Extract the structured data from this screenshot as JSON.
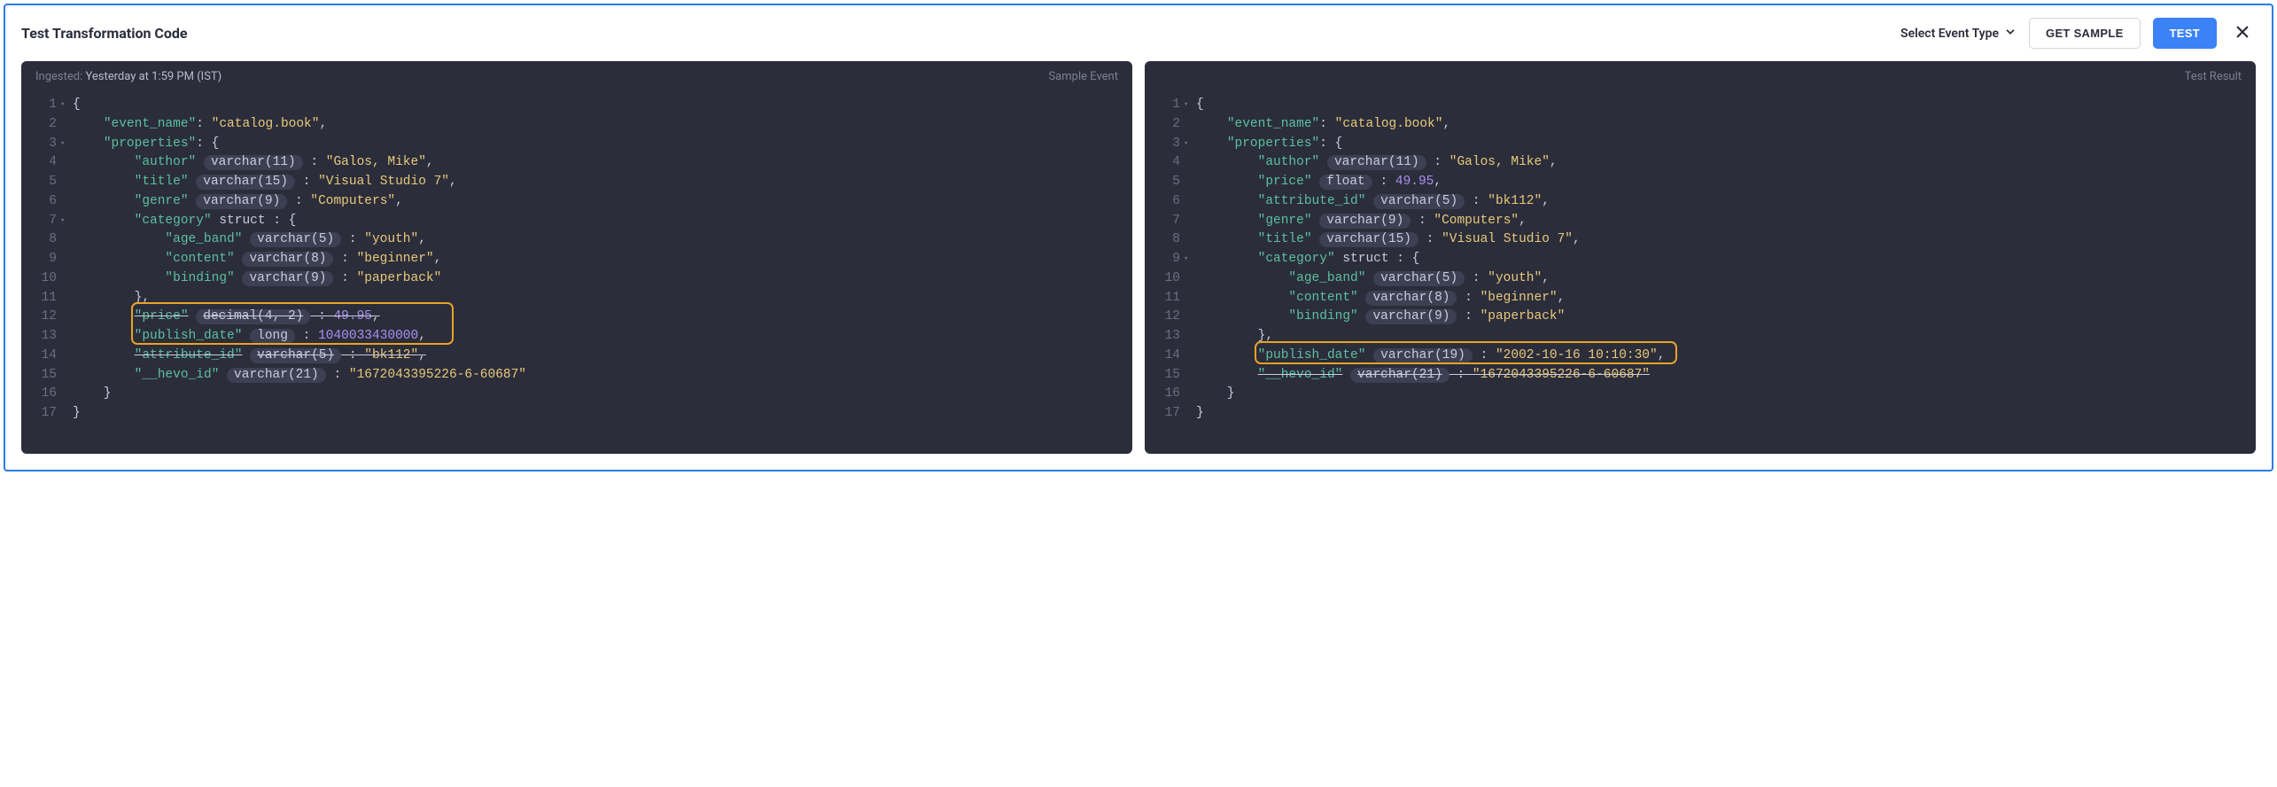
{
  "header": {
    "title": "Test Transformation Code",
    "select_event": "Select Event Type",
    "get_sample": "GET SAMPLE",
    "test": "TEST"
  },
  "left": {
    "ingested_label": "Ingested:",
    "ingested_time": "Yesterday at 1:59 PM (IST)",
    "tag": "Sample Event",
    "lines": [
      {
        "n": "1",
        "fold": "▾",
        "tokens": [
          {
            "t": "{",
            "c": "tok-punct"
          }
        ]
      },
      {
        "n": "2",
        "tokens": [
          {
            "t": "    "
          },
          {
            "t": "\"event_name\"",
            "c": "tok-key"
          },
          {
            "t": ": ",
            "c": "tok-punct"
          },
          {
            "t": "\"catalog.book\"",
            "c": "tok-str"
          },
          {
            "t": ",",
            "c": "tok-punct"
          }
        ]
      },
      {
        "n": "3",
        "fold": "▾",
        "tokens": [
          {
            "t": "    "
          },
          {
            "t": "\"properties\"",
            "c": "tok-key"
          },
          {
            "t": ": {",
            "c": "tok-punct"
          }
        ]
      },
      {
        "n": "4",
        "tokens": [
          {
            "t": "        "
          },
          {
            "t": "\"author\"",
            "c": "tok-key"
          },
          {
            "t": " "
          },
          {
            "t": "varchar(11)",
            "c": "tok-type"
          },
          {
            "t": " : ",
            "c": "tok-punct"
          },
          {
            "t": "\"Galos, Mike\"",
            "c": "tok-str"
          },
          {
            "t": ",",
            "c": "tok-punct"
          }
        ]
      },
      {
        "n": "5",
        "tokens": [
          {
            "t": "        "
          },
          {
            "t": "\"title\"",
            "c": "tok-key"
          },
          {
            "t": " "
          },
          {
            "t": "varchar(15)",
            "c": "tok-type"
          },
          {
            "t": " : ",
            "c": "tok-punct"
          },
          {
            "t": "\"Visual Studio 7\"",
            "c": "tok-str"
          },
          {
            "t": ",",
            "c": "tok-punct"
          }
        ]
      },
      {
        "n": "6",
        "tokens": [
          {
            "t": "        "
          },
          {
            "t": "\"genre\"",
            "c": "tok-key"
          },
          {
            "t": " "
          },
          {
            "t": "varchar(9)",
            "c": "tok-type"
          },
          {
            "t": " : ",
            "c": "tok-punct"
          },
          {
            "t": "\"Computers\"",
            "c": "tok-str"
          },
          {
            "t": ",",
            "c": "tok-punct"
          }
        ]
      },
      {
        "n": "7",
        "fold": "▾",
        "tokens": [
          {
            "t": "        "
          },
          {
            "t": "\"category\"",
            "c": "tok-key"
          },
          {
            "t": " "
          },
          {
            "t": "struct",
            "c": "tok-kw"
          },
          {
            "t": " : {",
            "c": "tok-punct"
          }
        ]
      },
      {
        "n": "8",
        "tokens": [
          {
            "t": "            "
          },
          {
            "t": "\"age_band\"",
            "c": "tok-key"
          },
          {
            "t": " "
          },
          {
            "t": "varchar(5)",
            "c": "tok-type"
          },
          {
            "t": " : ",
            "c": "tok-punct"
          },
          {
            "t": "\"youth\"",
            "c": "tok-str"
          },
          {
            "t": ",",
            "c": "tok-punct"
          }
        ]
      },
      {
        "n": "9",
        "tokens": [
          {
            "t": "            "
          },
          {
            "t": "\"content\"",
            "c": "tok-key"
          },
          {
            "t": " "
          },
          {
            "t": "varchar(8)",
            "c": "tok-type"
          },
          {
            "t": " : ",
            "c": "tok-punct"
          },
          {
            "t": "\"beginner\"",
            "c": "tok-str"
          },
          {
            "t": ",",
            "c": "tok-punct"
          }
        ]
      },
      {
        "n": "10",
        "tokens": [
          {
            "t": "            "
          },
          {
            "t": "\"binding\"",
            "c": "tok-key"
          },
          {
            "t": " "
          },
          {
            "t": "varchar(9)",
            "c": "tok-type"
          },
          {
            "t": " : ",
            "c": "tok-punct"
          },
          {
            "t": "\"paperback\"",
            "c": "tok-str"
          }
        ]
      },
      {
        "n": "11",
        "tokens": [
          {
            "t": "        },",
            "c": "tok-punct"
          }
        ]
      },
      {
        "n": "12",
        "tokens": [
          {
            "t": "        "
          },
          {
            "t": "\"price\"",
            "c": "tok-key strike"
          },
          {
            "t": " "
          },
          {
            "t": "decimal(4, 2)",
            "c": "tok-type strike"
          },
          {
            "t": " : ",
            "c": "tok-punct strike"
          },
          {
            "t": "49.95",
            "c": "tok-num strike"
          },
          {
            "t": ",",
            "c": "tok-punct strike"
          }
        ]
      },
      {
        "n": "13",
        "tokens": [
          {
            "t": "        "
          },
          {
            "t": "\"publish_date\"",
            "c": "tok-key"
          },
          {
            "t": " "
          },
          {
            "t": "long",
            "c": "tok-type"
          },
          {
            "t": " : ",
            "c": "tok-punct"
          },
          {
            "t": "1040033430000",
            "c": "tok-num"
          },
          {
            "t": ",",
            "c": "tok-punct"
          }
        ]
      },
      {
        "n": "14",
        "tokens": [
          {
            "t": "        "
          },
          {
            "t": "\"attribute_id\"",
            "c": "tok-key strike"
          },
          {
            "t": " "
          },
          {
            "t": "varchar(5)",
            "c": "tok-type strike"
          },
          {
            "t": " : ",
            "c": "tok-punct strike"
          },
          {
            "t": "\"bk112\"",
            "c": "tok-str strike"
          },
          {
            "t": ",",
            "c": "tok-punct strike"
          }
        ]
      },
      {
        "n": "15",
        "tokens": [
          {
            "t": "        "
          },
          {
            "t": "\"__hevo_id\"",
            "c": "tok-key"
          },
          {
            "t": " "
          },
          {
            "t": "varchar(21)",
            "c": "tok-type"
          },
          {
            "t": " : ",
            "c": "tok-punct"
          },
          {
            "t": "\"1672043395226-6-60687\"",
            "c": "tok-str"
          }
        ]
      },
      {
        "n": "16",
        "tokens": [
          {
            "t": "    }",
            "c": "tok-punct"
          }
        ]
      },
      {
        "n": "17",
        "tokens": [
          {
            "t": "}",
            "c": "tok-punct"
          }
        ]
      }
    ],
    "highlight": {
      "top_line": 12,
      "height_lines": 2,
      "left_ch": 8,
      "width_ch": 41
    }
  },
  "right": {
    "tag": "Test Result",
    "lines": [
      {
        "n": "1",
        "fold": "▾",
        "tokens": [
          {
            "t": "{",
            "c": "tok-punct"
          }
        ]
      },
      {
        "n": "2",
        "tokens": [
          {
            "t": "    "
          },
          {
            "t": "\"event_name\"",
            "c": "tok-key"
          },
          {
            "t": ": ",
            "c": "tok-punct"
          },
          {
            "t": "\"catalog.book\"",
            "c": "tok-str"
          },
          {
            "t": ",",
            "c": "tok-punct"
          }
        ]
      },
      {
        "n": "3",
        "fold": "▾",
        "tokens": [
          {
            "t": "    "
          },
          {
            "t": "\"properties\"",
            "c": "tok-key"
          },
          {
            "t": ": {",
            "c": "tok-punct"
          }
        ]
      },
      {
        "n": "4",
        "tokens": [
          {
            "t": "        "
          },
          {
            "t": "\"author\"",
            "c": "tok-key"
          },
          {
            "t": " "
          },
          {
            "t": "varchar(11)",
            "c": "tok-type"
          },
          {
            "t": " : ",
            "c": "tok-punct"
          },
          {
            "t": "\"Galos, Mike\"",
            "c": "tok-str"
          },
          {
            "t": ",",
            "c": "tok-punct"
          }
        ]
      },
      {
        "n": "5",
        "tokens": [
          {
            "t": "        "
          },
          {
            "t": "\"price\"",
            "c": "tok-key"
          },
          {
            "t": " "
          },
          {
            "t": "float",
            "c": "tok-type"
          },
          {
            "t": " : ",
            "c": "tok-punct"
          },
          {
            "t": "49.95",
            "c": "tok-num"
          },
          {
            "t": ",",
            "c": "tok-punct"
          }
        ]
      },
      {
        "n": "6",
        "tokens": [
          {
            "t": "        "
          },
          {
            "t": "\"attribute_id\"",
            "c": "tok-key"
          },
          {
            "t": " "
          },
          {
            "t": "varchar(5)",
            "c": "tok-type"
          },
          {
            "t": " : ",
            "c": "tok-punct"
          },
          {
            "t": "\"bk112\"",
            "c": "tok-str"
          },
          {
            "t": ",",
            "c": "tok-punct"
          }
        ]
      },
      {
        "n": "7",
        "tokens": [
          {
            "t": "        "
          },
          {
            "t": "\"genre\"",
            "c": "tok-key"
          },
          {
            "t": " "
          },
          {
            "t": "varchar(9)",
            "c": "tok-type"
          },
          {
            "t": " : ",
            "c": "tok-punct"
          },
          {
            "t": "\"Computers\"",
            "c": "tok-str"
          },
          {
            "t": ",",
            "c": "tok-punct"
          }
        ]
      },
      {
        "n": "8",
        "tokens": [
          {
            "t": "        "
          },
          {
            "t": "\"title\"",
            "c": "tok-key"
          },
          {
            "t": " "
          },
          {
            "t": "varchar(15)",
            "c": "tok-type"
          },
          {
            "t": " : ",
            "c": "tok-punct"
          },
          {
            "t": "\"Visual Studio 7\"",
            "c": "tok-str"
          },
          {
            "t": ",",
            "c": "tok-punct"
          }
        ]
      },
      {
        "n": "9",
        "fold": "▾",
        "tokens": [
          {
            "t": "        "
          },
          {
            "t": "\"category\"",
            "c": "tok-key"
          },
          {
            "t": " "
          },
          {
            "t": "struct",
            "c": "tok-kw"
          },
          {
            "t": " : {",
            "c": "tok-punct"
          }
        ]
      },
      {
        "n": "10",
        "tokens": [
          {
            "t": "            "
          },
          {
            "t": "\"age_band\"",
            "c": "tok-key"
          },
          {
            "t": " "
          },
          {
            "t": "varchar(5)",
            "c": "tok-type"
          },
          {
            "t": " : ",
            "c": "tok-punct"
          },
          {
            "t": "\"youth\"",
            "c": "tok-str"
          },
          {
            "t": ",",
            "c": "tok-punct"
          }
        ]
      },
      {
        "n": "11",
        "tokens": [
          {
            "t": "            "
          },
          {
            "t": "\"content\"",
            "c": "tok-key"
          },
          {
            "t": " "
          },
          {
            "t": "varchar(8)",
            "c": "tok-type"
          },
          {
            "t": " : ",
            "c": "tok-punct"
          },
          {
            "t": "\"beginner\"",
            "c": "tok-str"
          },
          {
            "t": ",",
            "c": "tok-punct"
          }
        ]
      },
      {
        "n": "12",
        "tokens": [
          {
            "t": "            "
          },
          {
            "t": "\"binding\"",
            "c": "tok-key"
          },
          {
            "t": " "
          },
          {
            "t": "varchar(9)",
            "c": "tok-type"
          },
          {
            "t": " : ",
            "c": "tok-punct"
          },
          {
            "t": "\"paperback\"",
            "c": "tok-str"
          }
        ]
      },
      {
        "n": "13",
        "tokens": [
          {
            "t": "        },",
            "c": "tok-punct"
          }
        ]
      },
      {
        "n": "14",
        "tokens": [
          {
            "t": "        "
          },
          {
            "t": "\"publish_date\"",
            "c": "tok-key"
          },
          {
            "t": " "
          },
          {
            "t": "varchar(19)",
            "c": "tok-type"
          },
          {
            "t": " : ",
            "c": "tok-punct"
          },
          {
            "t": "\"2002-10-16 10:10:30\"",
            "c": "tok-str"
          },
          {
            "t": ",",
            "c": "tok-punct"
          }
        ]
      },
      {
        "n": "15",
        "tokens": [
          {
            "t": "        "
          },
          {
            "t": "\"__hevo_id\"",
            "c": "tok-key strike"
          },
          {
            "t": " "
          },
          {
            "t": "varchar(21)",
            "c": "tok-type strike"
          },
          {
            "t": " : ",
            "c": "tok-punct strike"
          },
          {
            "t": "\"1672043395226-6-60687\"",
            "c": "tok-str strike"
          }
        ]
      },
      {
        "n": "16",
        "tokens": [
          {
            "t": "    }",
            "c": "tok-punct"
          }
        ]
      },
      {
        "n": "17",
        "tokens": [
          {
            "t": "}",
            "c": "tok-punct"
          }
        ]
      }
    ],
    "highlight": {
      "top_line": 14,
      "height_lines": 1,
      "left_ch": 8,
      "width_ch": 54
    }
  }
}
